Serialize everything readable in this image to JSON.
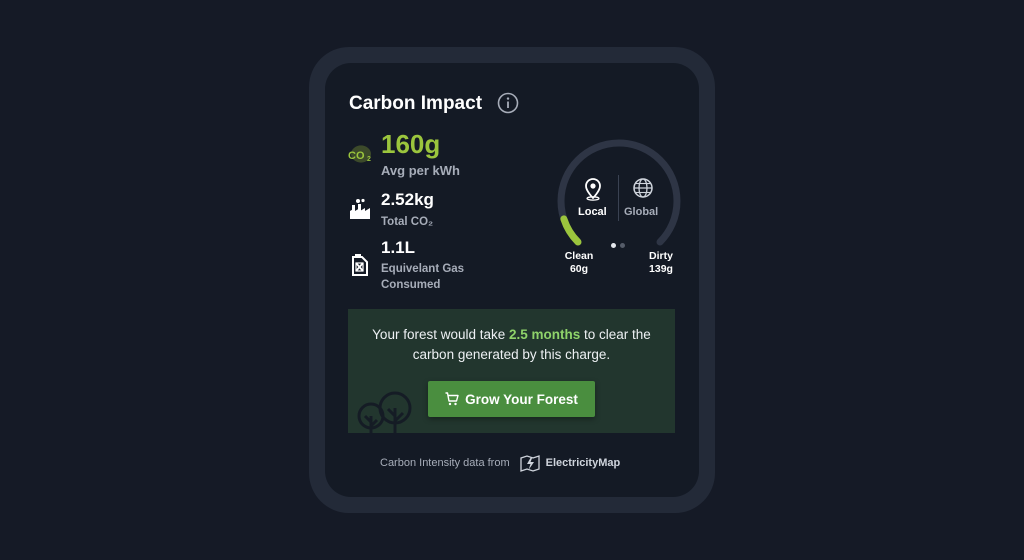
{
  "card": {
    "title": "Carbon Impact",
    "info_icon": "info-icon"
  },
  "stats": {
    "avg": {
      "icon": "co2-icon",
      "value": "160g",
      "label": "Avg per kWh"
    },
    "total": {
      "icon": "factory-icon",
      "value": "2.52kg",
      "label": "Total CO₂"
    },
    "gas": {
      "icon": "gas-can-icon",
      "value": "1.1L",
      "label": "Equivelant Gas Consumed"
    }
  },
  "gauge": {
    "tabs": [
      {
        "label": "Local",
        "icon": "location-pin-icon",
        "active": true
      },
      {
        "label": "Global",
        "icon": "globe-icon",
        "active": false
      }
    ],
    "clean_label": "Clean",
    "clean_value": "60g",
    "dirty_label": "Dirty",
    "dirty_value": "139g",
    "fill_fraction": 0.1,
    "page_dots": 2,
    "active_dot": 0,
    "colors": {
      "track": "#2e3545",
      "fill": "#9bc53d"
    }
  },
  "forest": {
    "text_before": "Your forest would take ",
    "highlight": "2.5 months",
    "text_after": " to clear the carbon generated by this charge.",
    "button_label": "Grow Your Forest",
    "button_icon": "cart-icon",
    "decor_icon": "trees-icon"
  },
  "footer": {
    "text": "Carbon Intensity data from",
    "brand": "ElectricityMap",
    "brand_icon": "electricitymap-logo-icon"
  },
  "colors": {
    "background": "#151a26",
    "frame": "#232a38",
    "card": "#141a25",
    "accent": "#9bc53d",
    "highlight": "#8fd36a",
    "button": "#4a8e3f",
    "forest_panel": "#22362e"
  }
}
